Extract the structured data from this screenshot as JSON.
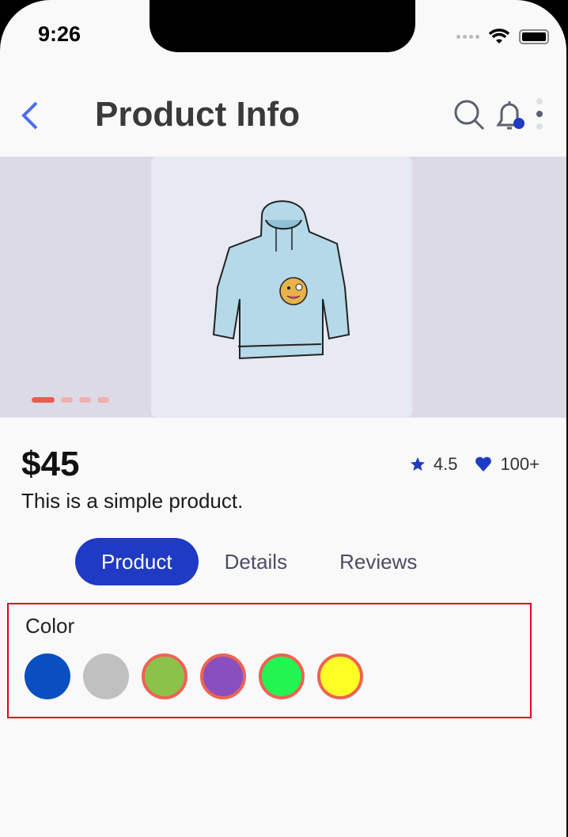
{
  "status_bar": {
    "time": "9:26"
  },
  "header": {
    "title": "Product Info"
  },
  "carousel": {
    "slide_count": 4,
    "active_index": 0
  },
  "product": {
    "price": "$45",
    "description": "This is a simple product.",
    "rating": "4.5",
    "likes": "100+"
  },
  "tabs": [
    {
      "label": "Product",
      "active": true
    },
    {
      "label": "Details",
      "active": false
    },
    {
      "label": "Reviews",
      "active": false
    }
  ],
  "color_section": {
    "label": "Color",
    "swatches": [
      {
        "color": "#0a4fc1",
        "selected": false
      },
      {
        "color": "#c0c0c0",
        "selected": false
      },
      {
        "color": "#8bc34a",
        "selected": true
      },
      {
        "color": "#8a4fbf",
        "selected": true
      },
      {
        "color": "#22f552",
        "selected": true
      },
      {
        "color": "#ffff26",
        "selected": true
      }
    ]
  },
  "colors": {
    "accent": "#1f3ac3",
    "back": "#4a6cf7",
    "dot_active": "#ef5a50",
    "highlight_border": "#e5001c"
  }
}
